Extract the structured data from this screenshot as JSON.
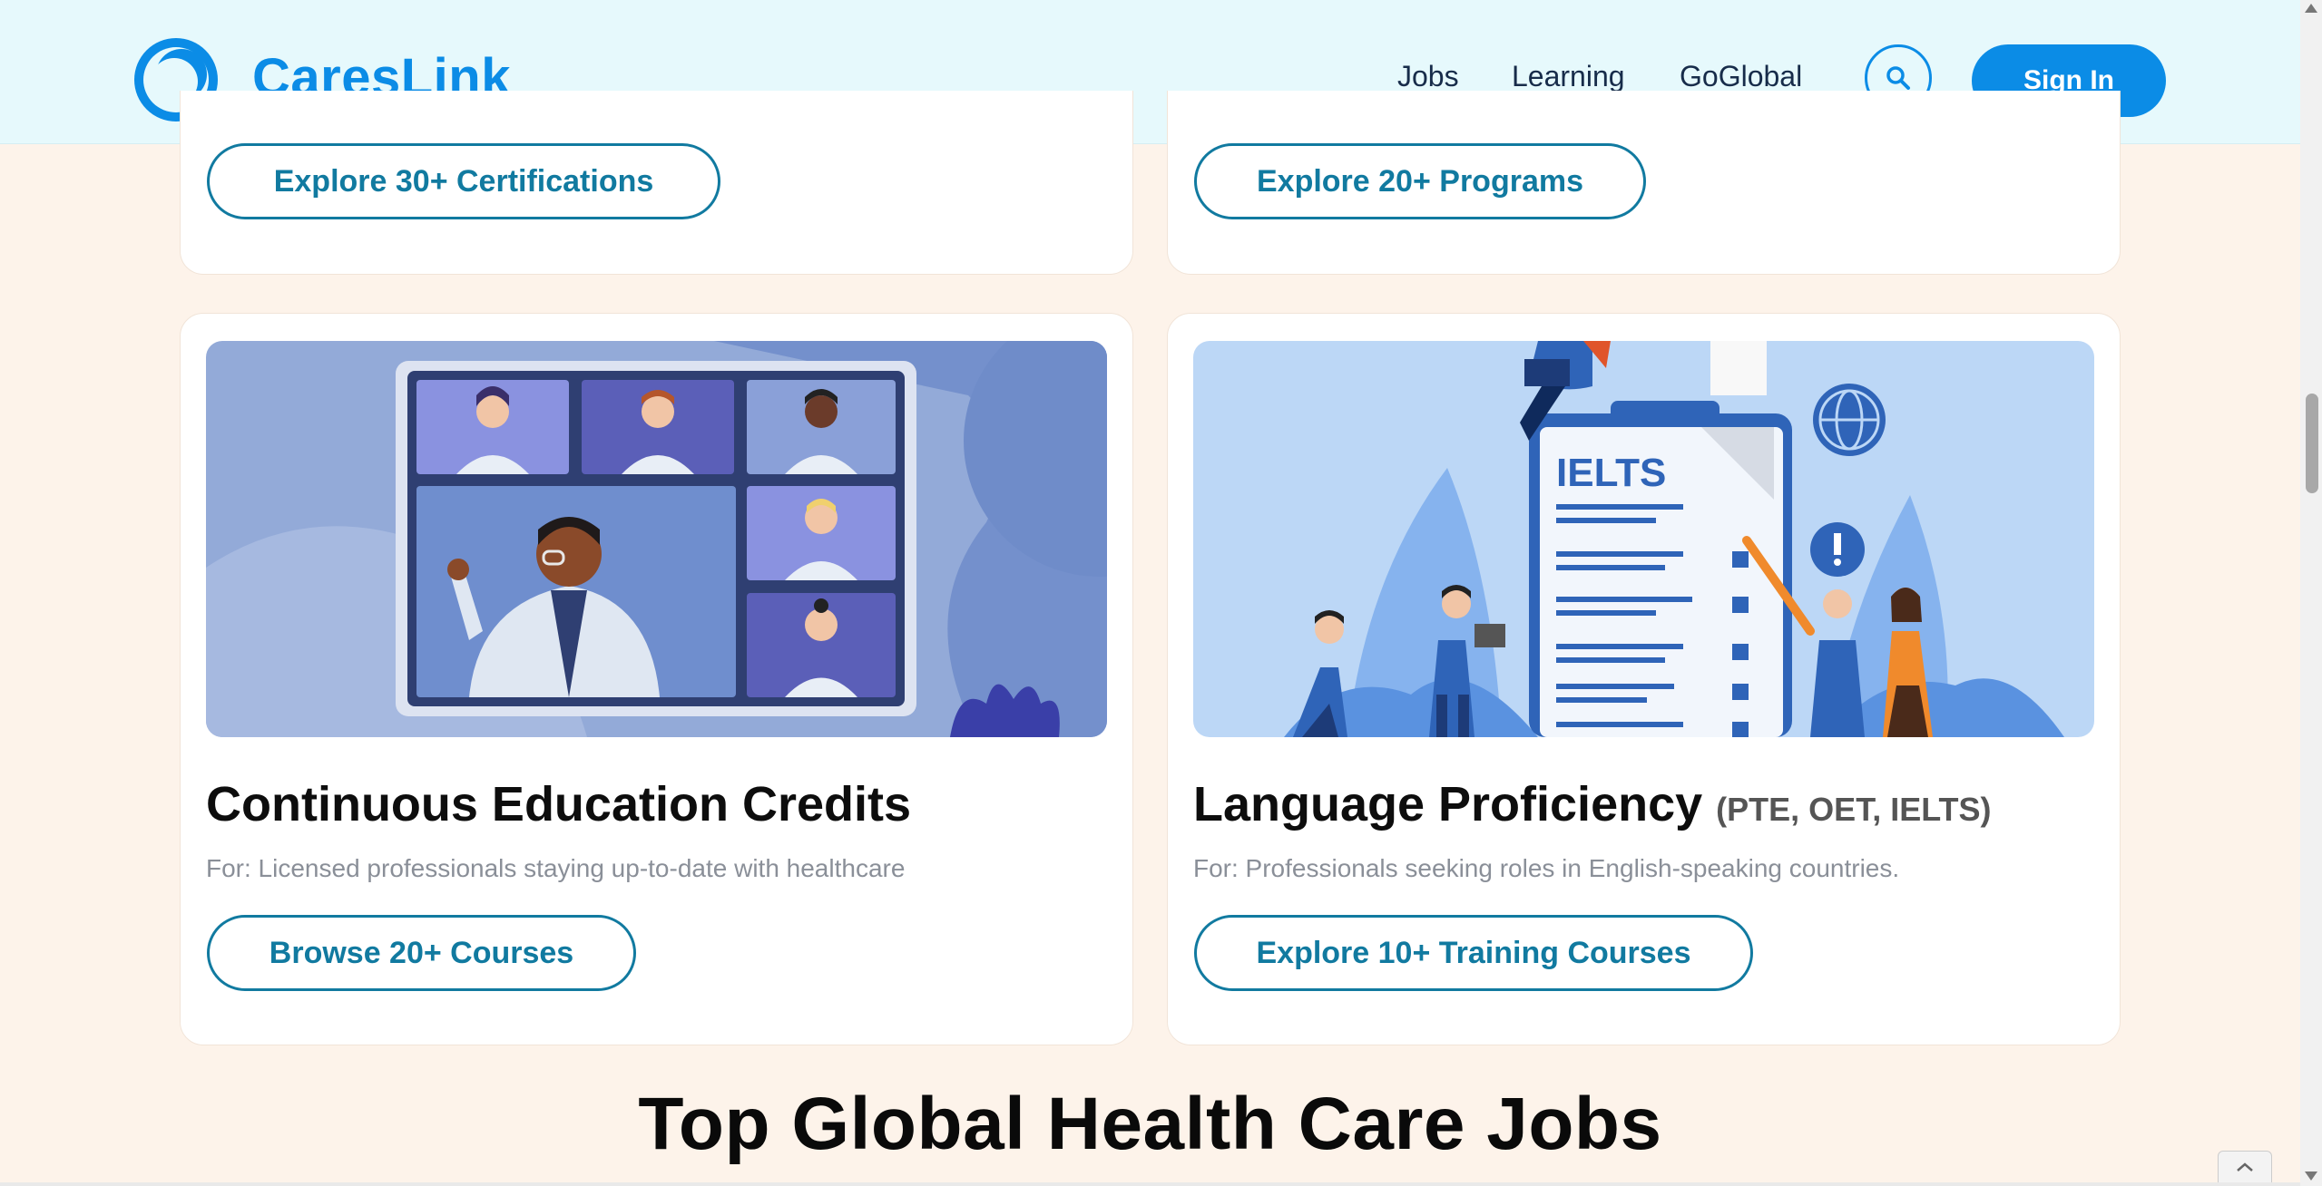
{
  "header": {
    "brand": "CaresLink",
    "nav": [
      "Jobs",
      "Learning",
      "GoGlobal"
    ],
    "signin_label": "Sign In"
  },
  "cards": {
    "top_left_button": "Explore 30+ Certifications",
    "top_right_button": "Explore 20+ Programs",
    "education": {
      "title": "Continuous Education Credits",
      "desc": "For: Licensed professionals staying up-to-date with healthcare",
      "button": "Browse 20+ Courses"
    },
    "language": {
      "title": "Language Proficiency",
      "title_sub": "(PTE, OET, IELTS)",
      "image_text": "IELTS",
      "desc": "For: Professionals seeking roles in English-speaking countries.",
      "button": "Explore 10+ Training Courses"
    }
  },
  "section_heading": "Top Global Health Care Jobs",
  "colors": {
    "brand_blue": "#0b8ce6",
    "teal_button": "#117aa0",
    "header_bg": "#e6f9fc",
    "page_bg": "#fdf3ea"
  }
}
